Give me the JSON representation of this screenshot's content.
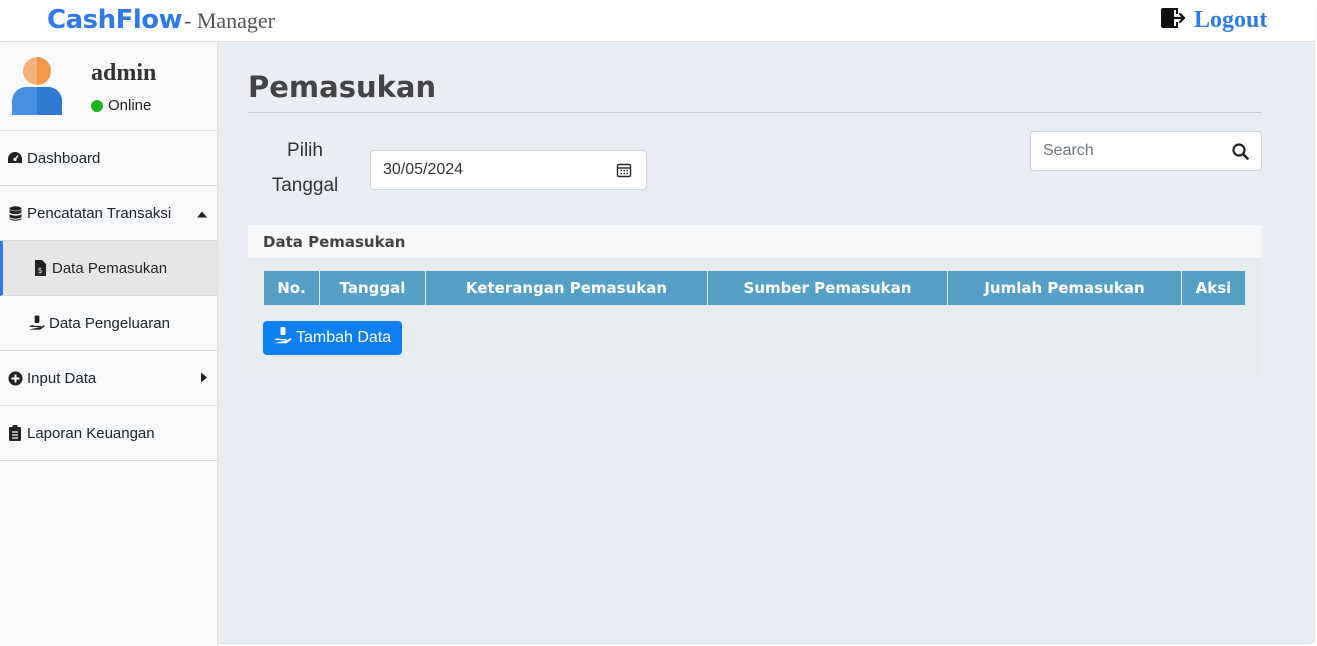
{
  "header": {
    "brand": "CashFlow",
    "brand_sub": "- Manager",
    "logout_label": "Logout",
    "logout_icon": "door-exit-icon"
  },
  "user": {
    "name": "admin",
    "status": "Online",
    "status_color": "#1db31d"
  },
  "sidebar": {
    "items": [
      {
        "label": "Dashboard",
        "icon": "gauge-icon"
      },
      {
        "label": "Pencatatan Transaksi",
        "icon": "database-icon",
        "caret": "up"
      },
      {
        "label": "Data Pemasukan",
        "icon": "invoice-dollar-icon",
        "active": true
      },
      {
        "label": "Data Pengeluaran",
        "icon": "hand-holding-dollar-icon"
      },
      {
        "label": "Input Data",
        "icon": "plus-circle-icon",
        "caret": "right"
      },
      {
        "label": "Laporan Keuangan",
        "icon": "clipboard-list-icon"
      }
    ]
  },
  "main": {
    "title": "Pemasukan",
    "date_label_line1": "Pilih",
    "date_label_line2": "Tanggal",
    "date_value": "30/05/2024",
    "search_placeholder": "Search",
    "card_title": "Data Pemasukan",
    "table_headers": [
      "No.",
      "Tanggal",
      "Keterangan Pemasukan",
      "Sumber Pemasukan",
      "Jumlah Pemasukan",
      "Aksi"
    ],
    "add_button_label": "Tambah Data"
  },
  "colors": {
    "accent": "#2f7be6",
    "table_header": "#54a0c6",
    "button": "#0d7ff2",
    "main_bg": "#e9eef4"
  }
}
